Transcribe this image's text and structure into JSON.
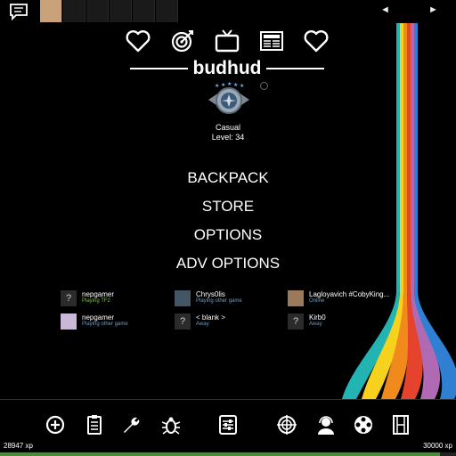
{
  "header": {
    "icons": [
      "heart-icon",
      "target-icon",
      "tv-icon",
      "news-icon",
      "heart-icon"
    ],
    "player_name": "budhud"
  },
  "rank": {
    "mode": "Casual",
    "level": "Level: 34"
  },
  "menu": {
    "items": [
      "BACKPACK",
      "STORE",
      "OPTIONS",
      "ADV OPTIONS"
    ]
  },
  "friends": [
    {
      "name": "nepgamer",
      "status": "Playing TF2",
      "status_type": "green",
      "pic": "?"
    },
    {
      "name": "Chrys0lis",
      "status": "Playing other game",
      "status_type": "blue",
      "pic": ""
    },
    {
      "name": "Lagloyavich #CobyKing...",
      "status": "Online",
      "status_type": "blue",
      "pic": ""
    },
    {
      "name": "nepgamer",
      "status": "Playing other game",
      "status_type": "blue",
      "pic": ""
    },
    {
      "name": "< blank >",
      "status": "Away",
      "status_type": "blue",
      "pic": "?"
    },
    {
      "name": "Kirb0",
      "status": "Away",
      "status_type": "blue",
      "pic": "?"
    }
  ],
  "nav": {
    "prev": "◄",
    "next": "►"
  },
  "bottom_icons": [
    "create-server-icon",
    "quests-icon",
    "wrench-icon",
    "bug-icon",
    "settings-sliders-icon",
    "server-browser-icon",
    "support-icon",
    "replay-icon",
    "film-icon"
  ],
  "xp": {
    "current": "28947 xp",
    "target": "30000 xp",
    "progress": 0.965
  },
  "colors": {
    "rainbow": [
      "#22b3b3",
      "#f6d21e",
      "#f08a1c",
      "#e5432b",
      "#b06ab3",
      "#2f7fd3"
    ]
  }
}
